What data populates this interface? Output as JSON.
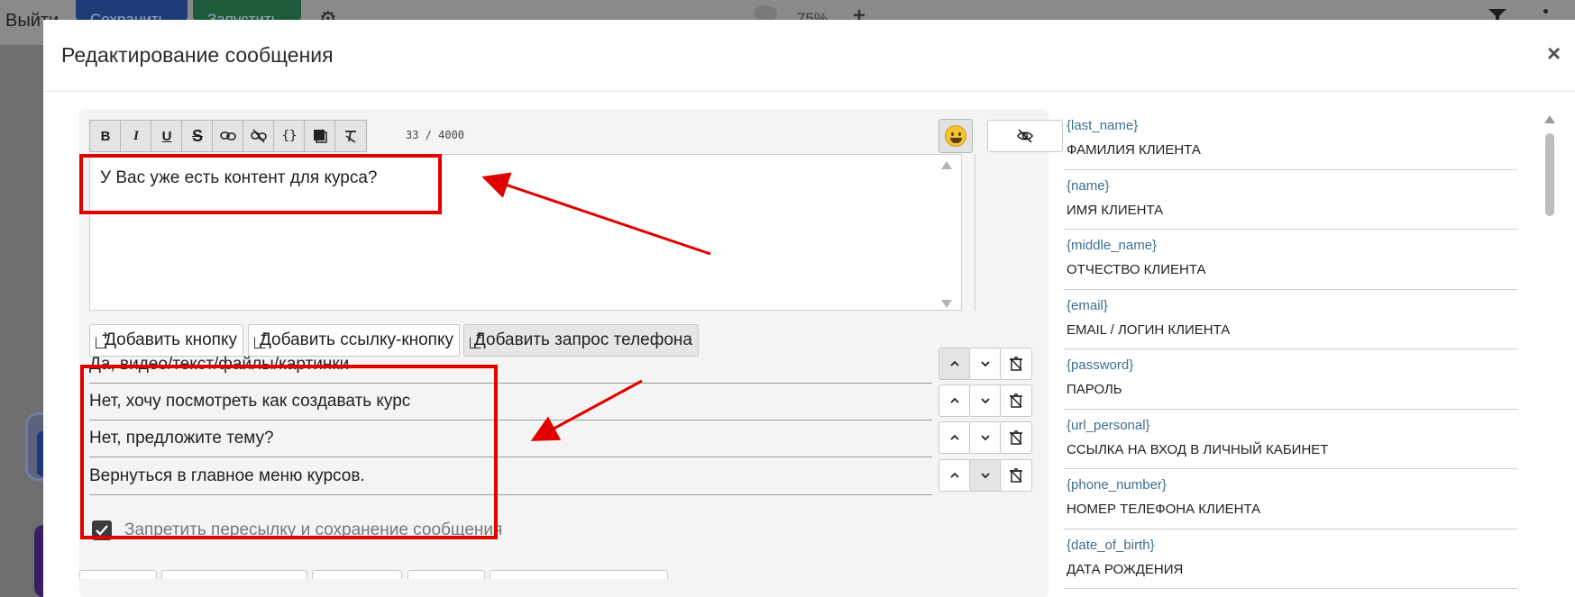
{
  "background": {
    "exit_label": "Выйти",
    "save_label": "Сохранить",
    "run_label": "Запустить",
    "zoom": "75%"
  },
  "modal": {
    "title": "Редактирование сообщения",
    "close_label": "×"
  },
  "toolbar": {
    "buttons": [
      {
        "name": "bold",
        "label": "B"
      },
      {
        "name": "italic",
        "label": "I"
      },
      {
        "name": "underline",
        "label": "U"
      },
      {
        "name": "strikethrough",
        "label": "S"
      },
      {
        "name": "link",
        "label": "link-icon"
      },
      {
        "name": "unlink",
        "label": "unlink-icon"
      },
      {
        "name": "code",
        "label": "{}"
      },
      {
        "name": "spoiler",
        "label": "spoiler-icon"
      },
      {
        "name": "clear-format",
        "label": "clear-format-icon"
      }
    ],
    "counter": "33 / 4000"
  },
  "editor": {
    "text": "У Вас уже есть контент для курса?"
  },
  "add_buttons": [
    {
      "label": "Добавить кнопку"
    },
    {
      "label": "Добавить ссылку-кнопку"
    },
    {
      "label": "Добавить запрос телефона"
    }
  ],
  "reply_buttons": [
    {
      "label": "Да, видео/текст/файлы/картинки"
    },
    {
      "label": "Нет, хочу посмотреть как создавать курс"
    },
    {
      "label": "Нет, предложите тему?"
    },
    {
      "label": "Вернуться в главное меню курсов."
    }
  ],
  "forward_protection": {
    "label": "Запретить пересылку и сохранение сообщения",
    "checked": true
  },
  "variables": [
    {
      "key": "{last_name}",
      "value": "ФАМИЛИЯ КЛИЕНТА"
    },
    {
      "key": "{name}",
      "value": "ИМЯ КЛИЕНТА"
    },
    {
      "key": "{middle_name}",
      "value": "ОТЧЕСТВО КЛИЕНТА"
    },
    {
      "key": "{email}",
      "value": "EMAIL / ЛОГИН КЛИЕНТА"
    },
    {
      "key": "{password}",
      "value": "ПАРОЛЬ"
    },
    {
      "key": "{url_personal}",
      "value": "ССЫЛКА НА ВХОД В ЛИЧНЫЙ КАБИНЕТ"
    },
    {
      "key": "{phone_number}",
      "value": "НОМЕР ТЕЛЕФОНА КЛИЕНТА"
    },
    {
      "key": "{date_of_birth}",
      "value": "ДАТА РОЖДЕНИЯ"
    }
  ],
  "colors": {
    "annotation": "#e00000",
    "variable_key": "#3f6f94"
  }
}
